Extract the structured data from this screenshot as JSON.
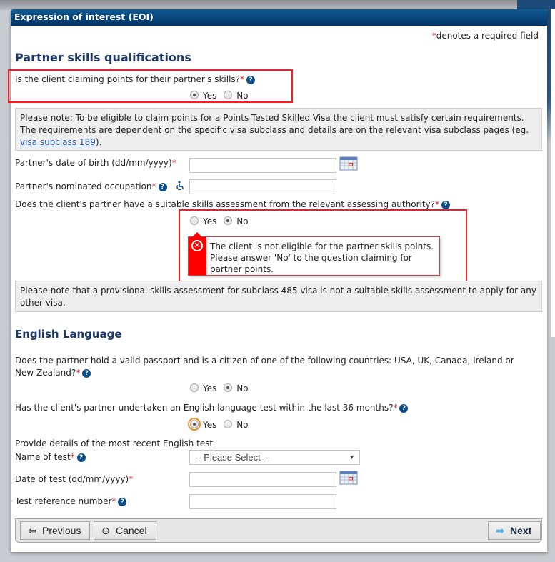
{
  "window": {
    "title": "Expression of interest (EOI)"
  },
  "required_note": {
    "asterisk": "*",
    "text": "denotes a required field"
  },
  "partner_skills": {
    "heading": "Partner skills qualifications",
    "claiming_question": {
      "text": "Is the client claiming points for their partner's skills?",
      "required": "*",
      "options": [
        "Yes",
        "No"
      ],
      "selected": "Yes"
    },
    "note": {
      "text": "Please note: To be eligible to claim points for a Points Tested Skilled Visa the client must satisfy certain requirements. The requirements are dependent on the specific visa subclass and details are on the relevant visa subclass pages (eg. ",
      "link": "visa subclass 189",
      "suffix": ")."
    },
    "dob": {
      "label": "Partner's date of birth (dd/mm/yyyy)",
      "required": "*",
      "value": ""
    },
    "occupation": {
      "label": "Partner's nominated occupation",
      "required": "*",
      "value": ""
    },
    "assessment_question": {
      "text": "Does the client's partner have a suitable skills assessment from the relevant assessing authority?",
      "required": "*",
      "options": [
        "Yes",
        "No"
      ],
      "selected": "No"
    },
    "error": {
      "message": "The client is not eligible for the partner skills points. Please answer 'No' to the question claiming for partner points."
    },
    "provisional_note": "Please note that a provisional skills assessment for subclass 485 visa is not a suitable skills assessment to apply for any other visa."
  },
  "english": {
    "heading": "English Language",
    "passport_question": {
      "text": "Does the partner hold a valid passport and is a citizen of one of the following countries: USA, UK, Canada, Ireland or New Zealand?",
      "required": "*",
      "options": [
        "Yes",
        "No"
      ],
      "selected": "No"
    },
    "test_question": {
      "text": "Has the client's partner undertaken an English language test within the last 36 months?",
      "required": "*",
      "options": [
        "Yes",
        "No"
      ],
      "selected": "Yes"
    },
    "details_heading": "Provide details of the most recent English test",
    "name_of_test": {
      "label": "Name of test",
      "required": "*",
      "selected": "-- Please Select --"
    },
    "date_of_test": {
      "label": "Date of test (dd/mm/yyyy)",
      "required": "*",
      "value": ""
    },
    "reference": {
      "label": "Test reference number",
      "required": "*",
      "value": ""
    }
  },
  "icons": {
    "help": "?",
    "error": "✕",
    "dropdown": "▼",
    "previous": "⇦",
    "cancel": "⊖",
    "next": "➡"
  },
  "footer": {
    "previous": "Previous",
    "cancel": "Cancel",
    "next": "Next"
  },
  "colors": {
    "header": "#023466",
    "heading": "#1c3766",
    "required": "#d6202a",
    "error": "#ff0000",
    "highlight": "#ff1a1a"
  }
}
